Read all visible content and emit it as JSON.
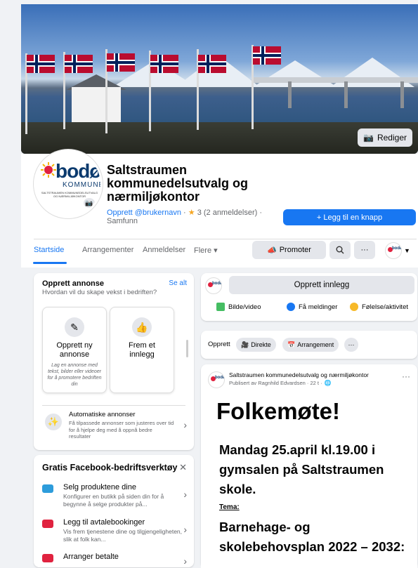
{
  "cover": {
    "edit_label": "Rediger"
  },
  "logo": {
    "word": "bodø",
    "sub": "KOMMUNE",
    "tiny": "SALTSTRAUMEN KOMMUNEDELSUTVALG OG NÆRMILJØKONTOR"
  },
  "page": {
    "title": "Saltstraumen kommunedelsutvalg og nærmiljøkontor",
    "create_username": "Opprett @brukernavn",
    "rating": "3 (2 anmeldelser)",
    "category": "Samfunn",
    "add_button": "+ Legg til en knapp"
  },
  "tabs": [
    {
      "label": "Startside"
    },
    {
      "label": "Arrangementer"
    },
    {
      "label": "Anmeldelser"
    },
    {
      "label": "Flere ▾"
    }
  ],
  "actions": {
    "promote": "Promoter",
    "more": "···"
  },
  "ad_card": {
    "title": "Opprett annonse",
    "see_all": "Se alt",
    "subtitle": "Hvordan vil du skape vekst i bedriften?",
    "tile1_title": "Opprett ny annonse",
    "tile1_desc": "Lag en annonse med tekst, bilder eller videoer for å promotere bedriften din",
    "tile2_title": "Frem et innlegg",
    "auto_title": "Automatiske annonser",
    "auto_desc": "Få tilpassede annonser som justeres over tid for å hjelpe deg med å oppnå bedre resultater"
  },
  "tools_card": {
    "title": "Gratis Facebook-bedriftsverktøy",
    "items": [
      {
        "title": "Selg produktene dine",
        "desc": "Konfigurer en butikk på siden din for å begynne å selge produkter på...",
        "color": "#2d9cdb"
      },
      {
        "title": "Legg til avtalebookinger",
        "desc": "Vis frem tjenestene dine og tilgjengeligheten, slik at folk kan...",
        "color": "#e0223f"
      },
      {
        "title": "Arranger betalte",
        "desc": "",
        "color": "#e0223f"
      }
    ]
  },
  "composer": {
    "create_post": "Opprett innlegg",
    "photo": "Bilde/video",
    "messages": "Få meldinger",
    "feeling": "Følelse/aktivitet"
  },
  "create_bar": {
    "label": "Opprett",
    "live": "Direkte",
    "event": "Arrangement",
    "more": "···"
  },
  "post": {
    "author": "Saltstraumen kommunedelsutvalg og nærmiljøkontor",
    "meta": "Publisert av Ragnhild Edvardsen · 22 t ·",
    "headline": "Folkemøte!",
    "line1": "Mandag 25.april kl.19.00 i gymsalen på Saltstraumen skole.",
    "theme_label": "Tema:",
    "topic": "Barnehage- og skolebehovsplan 2022 – 2032:"
  }
}
